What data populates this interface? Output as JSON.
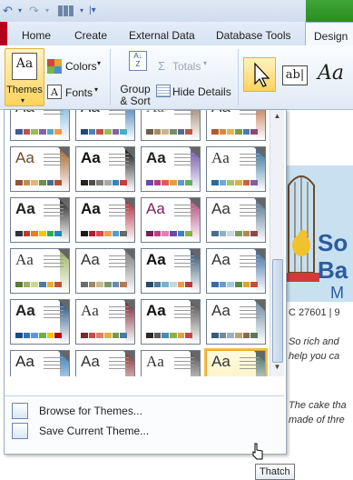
{
  "tabs": [
    "Home",
    "Create",
    "External Data",
    "Database Tools",
    "Design"
  ],
  "ribbon": {
    "themes_label": "Themes",
    "colors_label": "Colors",
    "fonts_label": "Fonts",
    "group_sort_line1": "Group",
    "group_sort_line2": "& Sort",
    "totals_label": "Totals",
    "hide_details_label": "Hide Details",
    "control_ab_label": "ab|",
    "control_aa_label": "Aa"
  },
  "gallery": {
    "menu": [
      "Browse for Themes...",
      "Save Current Theme..."
    ],
    "tooltip": "Thatch",
    "selected_index": 23
  },
  "document": {
    "banner_line1": "So",
    "banner_line2": "Ba",
    "banner_line3": "M",
    "address": "C 27601 | 9",
    "p1_line1": "So rich and",
    "p1_line2": "help you ca",
    "p2_line1": "The cake tha",
    "p2_line2": "made of thre"
  },
  "colors": {
    "accent": "#2b579a",
    "selection": "#f2c04c"
  }
}
